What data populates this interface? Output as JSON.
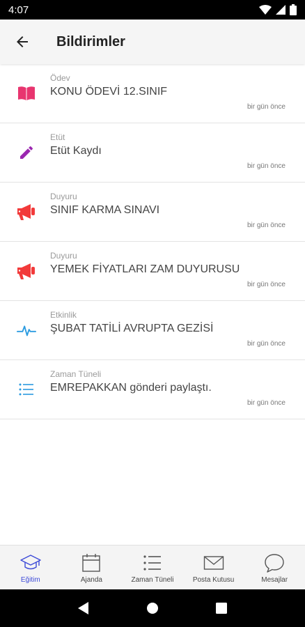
{
  "status_bar": {
    "time": "4:07"
  },
  "app_bar": {
    "title": "Bildirimler"
  },
  "notifications": [
    {
      "category": "Ödev",
      "title": "KONU ÖDEVİ 12.SINIF",
      "time": "bir gün önce",
      "icon": "book-icon",
      "color": "#e8356f"
    },
    {
      "category": "Etüt",
      "title": "Etüt Kaydı",
      "time": "bir gün önce",
      "icon": "pencil-icon",
      "color": "#9b27b0"
    },
    {
      "category": "Duyuru",
      "title": "SINIF KARMA SINAVI",
      "time": "bir gün önce",
      "icon": "megaphone-icon",
      "color": "#f23a3a"
    },
    {
      "category": "Duyuru",
      "title": "YEMEK FİYATLARI ZAM DUYURUSU",
      "time": "bir gün önce",
      "icon": "megaphone-icon",
      "color": "#f23a3a"
    },
    {
      "category": "Etkinlik",
      "title": "ŞUBAT TATİLİ AVRUPTA GEZİSİ",
      "time": "bir gün önce",
      "icon": "pulse-icon",
      "color": "#2b9be0"
    },
    {
      "category": "Zaman Tüneli",
      "title": "EMREPAKKAN gönderi paylaştı.",
      "time": "bir gün önce",
      "icon": "list-icon",
      "color": "#2b9be0"
    }
  ],
  "bottom_nav": [
    {
      "label": "Eğitim",
      "icon": "graduation-cap-icon",
      "active": true
    },
    {
      "label": "Ajanda",
      "icon": "calendar-icon",
      "active": false
    },
    {
      "label": "Zaman Tüneli",
      "icon": "list-icon",
      "active": false
    },
    {
      "label": "Posta Kutusu",
      "icon": "envelope-icon",
      "active": false
    },
    {
      "label": "Mesajlar",
      "icon": "chat-icon",
      "active": false
    }
  ],
  "colors": {
    "accent": "#3d4bd8",
    "app_bar_bg": "#f5f5f5",
    "divider": "#e3e3e3"
  }
}
